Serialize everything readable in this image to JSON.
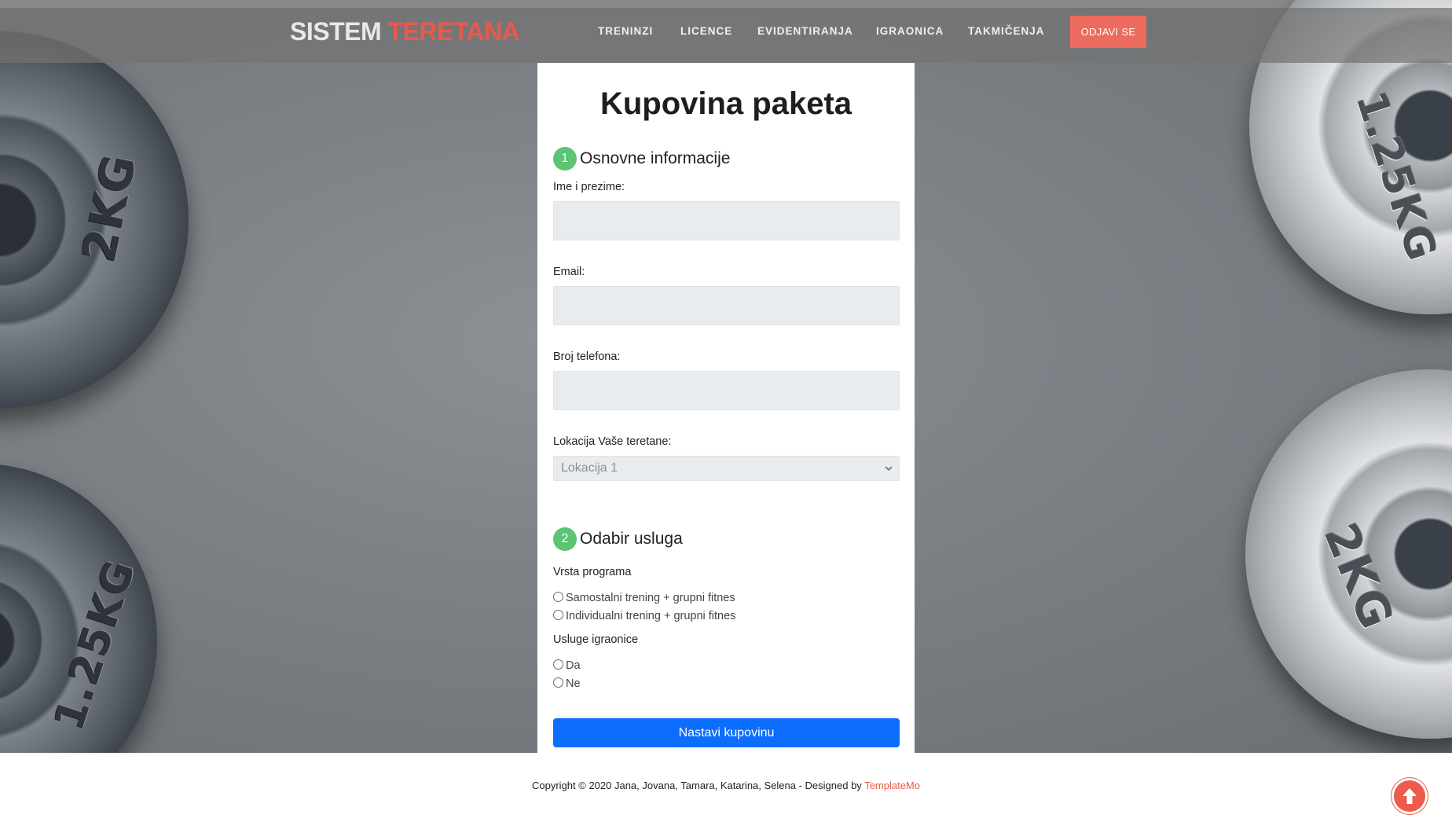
{
  "header": {
    "logo_part1": "SISTEM",
    "logo_part2": "TERETANA",
    "nav": [
      "TRENINZI",
      "LICENCE",
      "EVIDENTIRANJA",
      "IGRAONICA",
      "TAKMIČENJA"
    ],
    "logout_label": "ODJAVI SE"
  },
  "background": {
    "plate_labels": [
      "2KG",
      "1.25KG",
      "1.25KG",
      "2KG"
    ]
  },
  "form": {
    "title": "Kupovina paketa",
    "section1": {
      "number": "1",
      "title": "Osnovne informacije"
    },
    "fields": {
      "name_label": "Ime i prezime:",
      "name_value": "",
      "email_label": "Email:",
      "email_value": "",
      "phone_label": "Broj telefona:",
      "phone_value": "",
      "location_label": "Lokacija Vaše teretane:",
      "location_selected": "Lokacija 1"
    },
    "section2": {
      "number": "2",
      "title": "Odabir usluga"
    },
    "program_label": "Vrsta programa",
    "program_options": [
      "Samostalni trening + grupni fitnes",
      "Individualni trening + grupni fitnes"
    ],
    "playroom_label": "Usluge igraonice",
    "playroom_options": [
      "Da",
      "Ne"
    ],
    "submit_label": "Nastavi kupovinu"
  },
  "footer": {
    "text": "Copyright © 2020 Jana, Jovana, Tamara, Katarina, Selena - Designed by ",
    "link": "TemplateMo"
  },
  "colors": {
    "accent": "#e9594b",
    "step_badge": "#5cc473",
    "primary_button": "#0d6efd"
  },
  "icons": {
    "scroll_top": "arrow-up-circle-icon",
    "select_chevron": "chevron-down-icon"
  }
}
